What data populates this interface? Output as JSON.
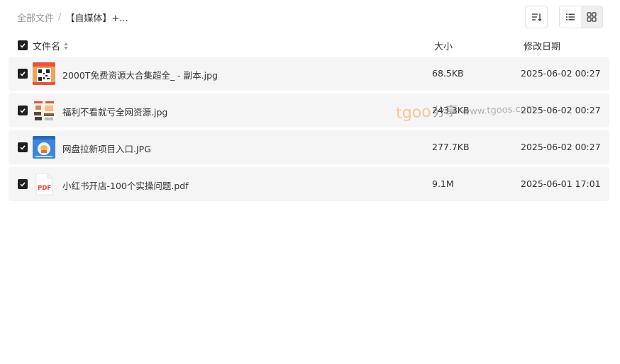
{
  "breadcrumb": {
    "root": "全部文件",
    "separator": "/",
    "current": "【自媒体】+..."
  },
  "toolbar": {
    "sort_icon": "sort-desc-icon",
    "list_view_icon": "list-view-icon",
    "grid_view_icon": "grid-view-icon",
    "active_view": "grid"
  },
  "table": {
    "headers": {
      "name": "文件名",
      "size": "大小",
      "date": "修改日期"
    },
    "rows": [
      {
        "name": "2000T免费资源大合集超全_ - 副本.jpg",
        "size": "68.5KB",
        "date": "2025-06-02 00:27",
        "icon": "qr-image-thumbnail",
        "checked": true
      },
      {
        "name": "福利不看就亏全网资源.jpg",
        "size": "243.3KB",
        "date": "2025-06-02 00:27",
        "icon": "image-thumbnail",
        "checked": true
      },
      {
        "name": "网盘拉新项目入口.JPG",
        "size": "277.7KB",
        "date": "2025-06-02 00:27",
        "icon": "image-thumbnail",
        "checked": true
      },
      {
        "name": "小红书开店-100个实操问题.pdf",
        "size": "9.1M",
        "date": "2025-06-01 17:01",
        "icon": "pdf-icon",
        "checked": true
      }
    ]
  },
  "watermark": {
    "brand": "tgoo",
    "cn": "分享",
    "url": "www.tgoos.com"
  },
  "colors": {
    "row_bg": "#f5f5f5",
    "checkbox": "#1f1f1f",
    "watermark_brand": "#f2a54a",
    "pdf_red": "#e8412c"
  }
}
